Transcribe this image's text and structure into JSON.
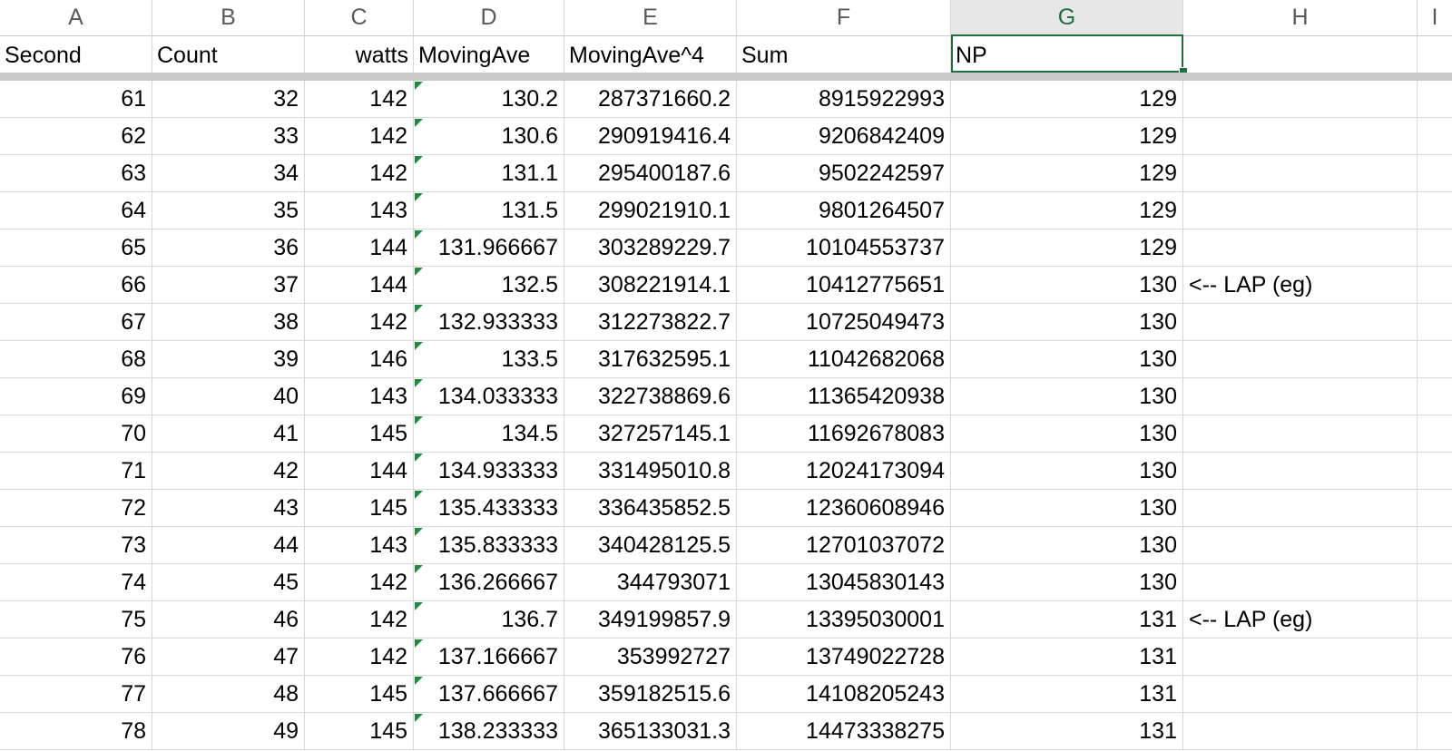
{
  "columns": [
    "A",
    "B",
    "C",
    "D",
    "E",
    "F",
    "G",
    "H",
    "I"
  ],
  "selected_column": "G",
  "header_row": [
    "Second",
    "Count",
    "watts",
    "MovingAve",
    "MovingAve^4",
    "Sum",
    "NP",
    "",
    ""
  ],
  "rows": [
    {
      "second": "61",
      "count": "32",
      "watts": "142",
      "moving_ave": "130.2",
      "moving_ave4": "287371660.2",
      "sum": "8915922993",
      "np": "129",
      "note": ""
    },
    {
      "second": "62",
      "count": "33",
      "watts": "142",
      "moving_ave": "130.6",
      "moving_ave4": "290919416.4",
      "sum": "9206842409",
      "np": "129",
      "note": ""
    },
    {
      "second": "63",
      "count": "34",
      "watts": "142",
      "moving_ave": "131.1",
      "moving_ave4": "295400187.6",
      "sum": "9502242597",
      "np": "129",
      "note": ""
    },
    {
      "second": "64",
      "count": "35",
      "watts": "143",
      "moving_ave": "131.5",
      "moving_ave4": "299021910.1",
      "sum": "9801264507",
      "np": "129",
      "note": ""
    },
    {
      "second": "65",
      "count": "36",
      "watts": "144",
      "moving_ave": "131.966667",
      "moving_ave4": "303289229.7",
      "sum": "10104553737",
      "np": "129",
      "note": ""
    },
    {
      "second": "66",
      "count": "37",
      "watts": "144",
      "moving_ave": "132.5",
      "moving_ave4": "308221914.1",
      "sum": "10412775651",
      "np": "130",
      "note": "<-- LAP (eg)"
    },
    {
      "second": "67",
      "count": "38",
      "watts": "142",
      "moving_ave": "132.933333",
      "moving_ave4": "312273822.7",
      "sum": "10725049473",
      "np": "130",
      "note": ""
    },
    {
      "second": "68",
      "count": "39",
      "watts": "146",
      "moving_ave": "133.5",
      "moving_ave4": "317632595.1",
      "sum": "11042682068",
      "np": "130",
      "note": ""
    },
    {
      "second": "69",
      "count": "40",
      "watts": "143",
      "moving_ave": "134.033333",
      "moving_ave4": "322738869.6",
      "sum": "11365420938",
      "np": "130",
      "note": ""
    },
    {
      "second": "70",
      "count": "41",
      "watts": "145",
      "moving_ave": "134.5",
      "moving_ave4": "327257145.1",
      "sum": "11692678083",
      "np": "130",
      "note": ""
    },
    {
      "second": "71",
      "count": "42",
      "watts": "144",
      "moving_ave": "134.933333",
      "moving_ave4": "331495010.8",
      "sum": "12024173094",
      "np": "130",
      "note": ""
    },
    {
      "second": "72",
      "count": "43",
      "watts": "145",
      "moving_ave": "135.433333",
      "moving_ave4": "336435852.5",
      "sum": "12360608946",
      "np": "130",
      "note": ""
    },
    {
      "second": "73",
      "count": "44",
      "watts": "143",
      "moving_ave": "135.833333",
      "moving_ave4": "340428125.5",
      "sum": "12701037072",
      "np": "130",
      "note": ""
    },
    {
      "second": "74",
      "count": "45",
      "watts": "142",
      "moving_ave": "136.266667",
      "moving_ave4": "344793071",
      "sum": "13045830143",
      "np": "130",
      "note": ""
    },
    {
      "second": "75",
      "count": "46",
      "watts": "142",
      "moving_ave": "136.7",
      "moving_ave4": "349199857.9",
      "sum": "13395030001",
      "np": "131",
      "note": "<-- LAP (eg)"
    },
    {
      "second": "76",
      "count": "47",
      "watts": "142",
      "moving_ave": "137.166667",
      "moving_ave4": "353992727",
      "sum": "13749022728",
      "np": "131",
      "note": ""
    },
    {
      "second": "77",
      "count": "48",
      "watts": "145",
      "moving_ave": "137.666667",
      "moving_ave4": "359182515.6",
      "sum": "14108205243",
      "np": "131",
      "note": ""
    },
    {
      "second": "78",
      "count": "49",
      "watts": "145",
      "moving_ave": "138.233333",
      "moving_ave4": "365133031.3",
      "sum": "14473338275",
      "np": "131",
      "note": ""
    }
  ],
  "colors": {
    "accent": "#1f6e3f",
    "grid": "#d9d9d9",
    "warning_triangle": "#1e8a3c"
  },
  "icons": {
    "cell_flag": "green-triangle-icon"
  }
}
